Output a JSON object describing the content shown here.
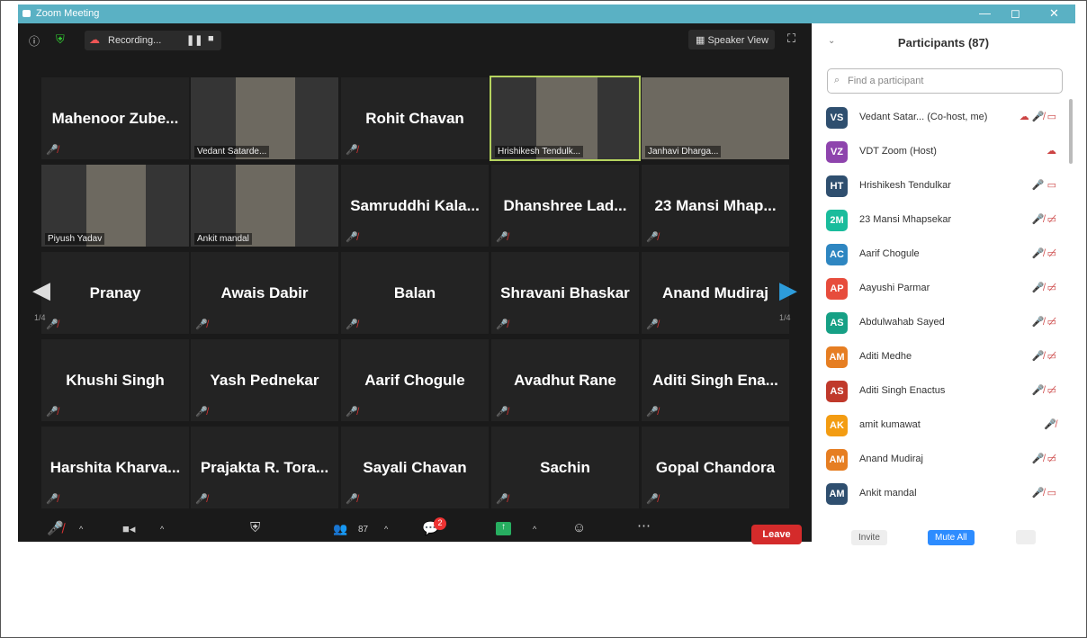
{
  "window": {
    "title": "Zoom Meeting",
    "controls": [
      "—",
      "◻",
      "✕"
    ]
  },
  "topbar": {
    "recording": "Recording...",
    "speaker_view": "Speaker View"
  },
  "grid": [
    [
      {
        "name": "Mahenoor Zube...",
        "video": false
      },
      {
        "name": "Vedant Satarde...",
        "video": true
      },
      {
        "name": "Rohit Chavan",
        "video": false
      },
      {
        "name": "Hrishikesh Tendulk...",
        "video": true,
        "active": true
      },
      {
        "name": "Janhavi Dharga...",
        "video": true
      }
    ],
    [
      {
        "name": "Piyush Yadav",
        "video": true
      },
      {
        "name": "Ankit mandal",
        "video": true
      },
      {
        "name": "Samruddhi Kala...",
        "video": false
      },
      {
        "name": "Dhanshree Lad...",
        "video": false
      },
      {
        "name": "23 Mansi Mhap...",
        "video": false
      }
    ],
    [
      {
        "name": "Pranay",
        "video": false
      },
      {
        "name": "Awais Dabir",
        "video": false
      },
      {
        "name": "Balan",
        "video": false
      },
      {
        "name": "Shravani Bhaskar",
        "video": false
      },
      {
        "name": "Anand Mudiraj",
        "video": false
      }
    ],
    [
      {
        "name": "Khushi Singh",
        "video": false
      },
      {
        "name": "Yash Pednekar",
        "video": false
      },
      {
        "name": "Aarif Chogule",
        "video": false
      },
      {
        "name": "Avadhut Rane",
        "video": false
      },
      {
        "name": "Aditi Singh Ena...",
        "video": false
      }
    ],
    [
      {
        "name": "Harshita Kharva...",
        "video": false
      },
      {
        "name": "Prajakta R. Tora...",
        "video": false
      },
      {
        "name": "Sayali Chavan",
        "video": false
      },
      {
        "name": "Sachin",
        "video": false
      },
      {
        "name": "Gopal Chandora",
        "video": false
      }
    ]
  ],
  "pager": {
    "left": "1/4",
    "right": "1/4"
  },
  "bottombar": {
    "participants_count": "87",
    "chat_badge": "2",
    "leave": "Leave"
  },
  "panel": {
    "title": "Participants (87)",
    "search_placeholder": "Find a participant",
    "participants": [
      {
        "initials": "VS",
        "color": "#2f4f6f",
        "name": "Vedant Satar...  (Co-host, me)",
        "icons": "☁ 🎤̸ ▭"
      },
      {
        "initials": "VZ",
        "color": "#8e44ad",
        "name": "VDT Zoom (Host)",
        "icons": "☁"
      },
      {
        "initials": "HT",
        "color": "#2f4f6f",
        "name": "Hrishikesh Tendulkar",
        "icons": "🎤 ▭"
      },
      {
        "initials": "2M",
        "color": "#1abc9c",
        "name": "23 Mansi Mhapsekar",
        "icons": "🎤̸ ▭̸"
      },
      {
        "initials": "AC",
        "color": "#2e86c1",
        "name": "Aarif Chogule",
        "icons": "🎤̸ ▭̸"
      },
      {
        "initials": "AP",
        "color": "#e74c3c",
        "name": "Aayushi Parmar",
        "icons": "🎤̸ ▭̸"
      },
      {
        "initials": "AS",
        "color": "#16a085",
        "name": "Abdulwahab Sayed",
        "icons": "🎤̸ ▭̸"
      },
      {
        "initials": "AM",
        "color": "#e67e22",
        "name": "Aditi Medhe",
        "icons": "🎤̸ ▭̸"
      },
      {
        "initials": "AS",
        "color": "#c0392b",
        "name": "Aditi Singh Enactus",
        "icons": "🎤̸ ▭̸"
      },
      {
        "initials": "AK",
        "color": "#f39c12",
        "name": "amit kumawat",
        "icons": "🎤̸"
      },
      {
        "initials": "AM",
        "color": "#e67e22",
        "name": "Anand Mudiraj",
        "icons": "🎤̸ ▭̸"
      },
      {
        "initials": "AM",
        "color": "#2f4f6f",
        "name": "Ankit mandal",
        "icons": "🎤̸ ▭"
      }
    ],
    "footer": {
      "invite": "Invite",
      "mute_all": "Mute All"
    }
  }
}
